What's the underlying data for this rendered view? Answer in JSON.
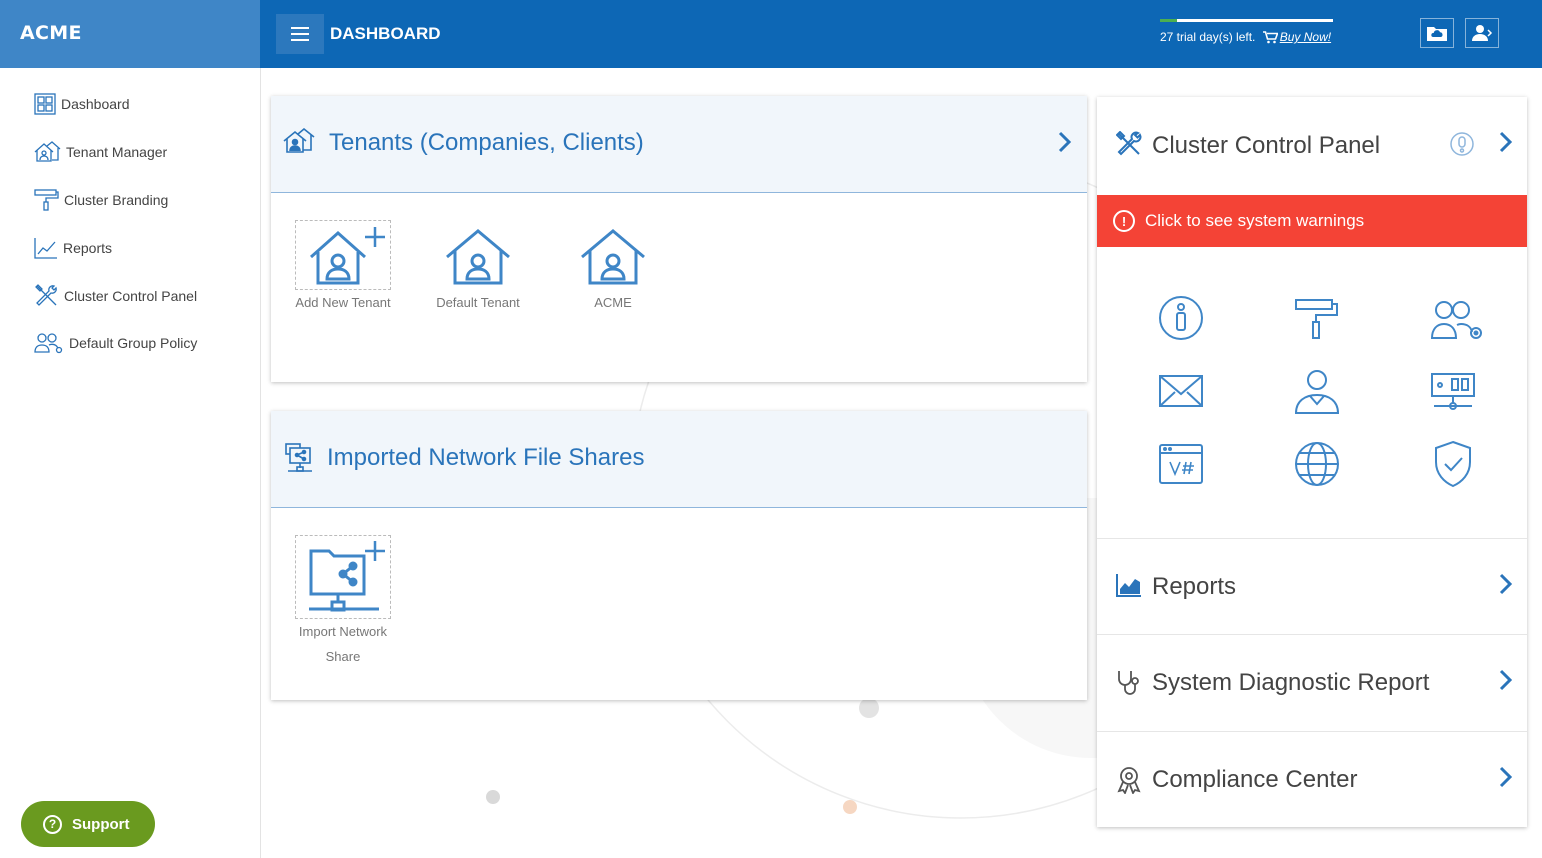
{
  "app": {
    "brand": "ACME",
    "page_title": "DASHBOARD"
  },
  "trial": {
    "text": "27 trial day(s) left.",
    "buy_label": "Buy Now!",
    "progress": 0.1
  },
  "sidebar": {
    "items": [
      {
        "label": "Dashboard",
        "icon": "grid-icon"
      },
      {
        "label": "Tenant Manager",
        "icon": "houses-icon"
      },
      {
        "label": "Cluster Branding",
        "icon": "paint-roller-icon"
      },
      {
        "label": "Reports",
        "icon": "chart-icon"
      },
      {
        "label": "Cluster Control Panel",
        "icon": "tools-icon"
      },
      {
        "label": "Default Group Policy",
        "icon": "users-gear-icon"
      }
    ],
    "support_label": "Support"
  },
  "tenants": {
    "title": "Tenants (Companies, Clients)",
    "tiles": [
      {
        "label": "Add New Tenant"
      },
      {
        "label": "Default Tenant"
      },
      {
        "label": "ACME"
      }
    ]
  },
  "shares": {
    "title": "Imported Network File Shares",
    "tiles": [
      {
        "label_line1": "Import Network",
        "label_line2": "Share"
      }
    ]
  },
  "control_panel": {
    "title": "Cluster Control Panel",
    "warning": "Click to see system warnings",
    "grid_icons": [
      "info-icon",
      "paint-roller-icon",
      "users-gear-icon",
      "mail-icon",
      "user-admin-icon",
      "server-icon",
      "vhost-icon",
      "globe-icon",
      "shield-check-icon"
    ],
    "rows": [
      {
        "label": "Reports",
        "icon": "chart-icon"
      },
      {
        "label": "System Diagnostic Report",
        "icon": "stethoscope-icon"
      },
      {
        "label": "Compliance Center",
        "icon": "compliance-icon"
      }
    ]
  },
  "colors": {
    "topbar": "#0d67b5",
    "brand_bg": "#3f86c7",
    "accent": "#2a74ba",
    "warning": "#f44336",
    "support": "#6a9a1f"
  }
}
